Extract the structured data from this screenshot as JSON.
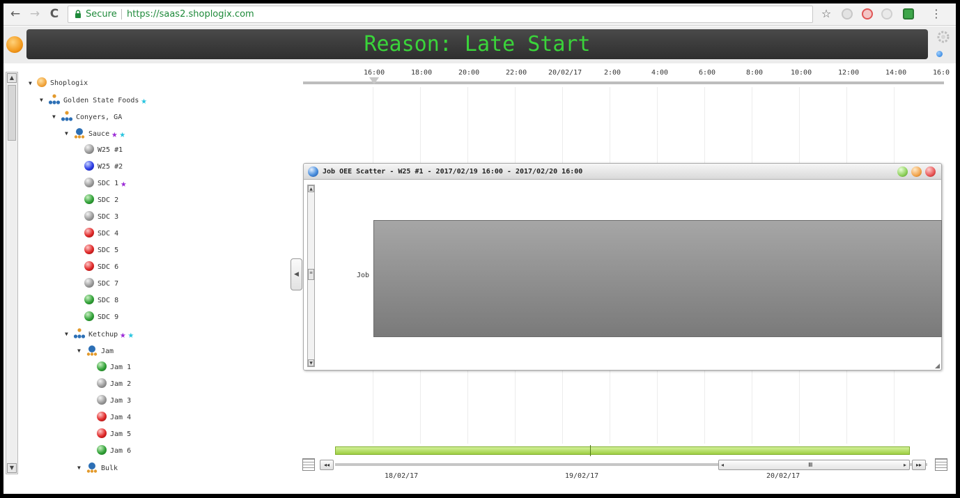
{
  "browser": {
    "back_glyph": "←",
    "forward_glyph": "→",
    "reload_glyph": "C",
    "secure_label": "Secure",
    "url": "https://saas2.shoplogix.com",
    "bookmark_glyph": "☆",
    "menu_glyph": "⋮"
  },
  "header": {
    "title": "Reason: Late Start"
  },
  "tree": {
    "root": "Shoplogix",
    "company": "Golden State Foods",
    "site": "Conyers, GA",
    "areas": [
      {
        "label": "Sauce"
      },
      {
        "label": "Ketchup"
      },
      {
        "label": "Jam"
      },
      {
        "label": "Bulk"
      }
    ],
    "machines": [
      {
        "label": "W25 #1",
        "status": "grey"
      },
      {
        "label": "W25 #2",
        "status": "blue"
      },
      {
        "label": "SDC 1",
        "status": "grey"
      },
      {
        "label": "SDC 2",
        "status": "green"
      },
      {
        "label": "SDC 3",
        "status": "grey"
      },
      {
        "label": "SDC 4",
        "status": "red"
      },
      {
        "label": "SDC 5",
        "status": "red"
      },
      {
        "label": "SDC 6",
        "status": "red"
      },
      {
        "label": "SDC 7",
        "status": "grey"
      },
      {
        "label": "SDC 8",
        "status": "green"
      },
      {
        "label": "SDC 9",
        "status": "green"
      },
      {
        "label": "Jam 1",
        "status": "green"
      },
      {
        "label": "Jam 2",
        "status": "grey"
      },
      {
        "label": "Jam 3",
        "status": "grey"
      },
      {
        "label": "Jam 4",
        "status": "red"
      },
      {
        "label": "Jam 5",
        "status": "red"
      },
      {
        "label": "Jam 6",
        "status": "green"
      }
    ],
    "expand_glyph": "▼",
    "star_glyph": "★"
  },
  "timeline": {
    "ticks": [
      "16:00",
      "18:00",
      "20:00",
      "22:00",
      "20/02/17",
      "2:00",
      "4:00",
      "6:00",
      "8:00",
      "10:00",
      "12:00",
      "14:00",
      "16:0"
    ]
  },
  "scatter_window": {
    "title": "Job OEE Scatter - W25 #1 - 2017/02/19 16:00 - 2017/02/20 16:00",
    "row_label": "Job"
  },
  "range_nav": {
    "dates": [
      "18/02/17",
      "19/02/17",
      "20/02/17"
    ],
    "first_glyph": "◂◂",
    "prev_glyph": "◂",
    "next_glyph": "▸",
    "last_glyph": "▸▸",
    "thumb_glyph": "IIII"
  },
  "colors": {
    "title_green": "#3ad43a",
    "status_grey": "#9c9c9c",
    "status_blue": "#2f3fe6",
    "status_green": "#34a33a",
    "status_red": "#e02a2a",
    "star_purple": "#9b2ad6",
    "star_cyan": "#27c4df",
    "range_green": "#9fcf43"
  }
}
